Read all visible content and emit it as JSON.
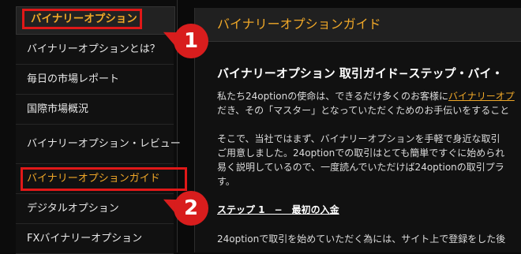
{
  "sidebar": {
    "heading": "バイナリーオプション",
    "items": [
      {
        "label": "バイナリーオプションとは？"
      },
      {
        "label": "毎日の市場レポート"
      },
      {
        "label": "国際市場概況"
      },
      {
        "label": "バイナリーオプション・レビュー"
      },
      {
        "label": "バイナリーオプションガイド"
      },
      {
        "label": "デジタルオプション"
      },
      {
        "label": "FXバイナリーオプション"
      }
    ]
  },
  "main": {
    "header": "バイナリーオプションガイド",
    "title": "バイナリーオプション 取引ガイド−ステップ・バイ・",
    "para1_line1_pre": "私たち24optionの使命は、できるだけ多くのお客様に",
    "para1_line1_link": "バイナリーオプ",
    "para1_line2": "だき、その「マスター」となっていただくためのお手伝いをすること",
    "para2_line1": "そこで、当社ではまず、バイナリーオプションを手軽で身近な取引",
    "para2_line2": "ご用意しました。24optionでの取引はとても簡単ですぐに始められ",
    "para2_line3": "易く説明しているので、一度読んでいただけば24optionの取引プラ",
    "para2_line4": "す。",
    "step_heading": "ステップ 1　−　最初の入金",
    "para3_line1": "24optionで取引を始めていただく為には、サイト上で登録をした後"
  },
  "annotations": {
    "badge1": "1",
    "badge2": "2",
    "accent_color": "#f0a828",
    "marker_color": "#d81d1d"
  }
}
